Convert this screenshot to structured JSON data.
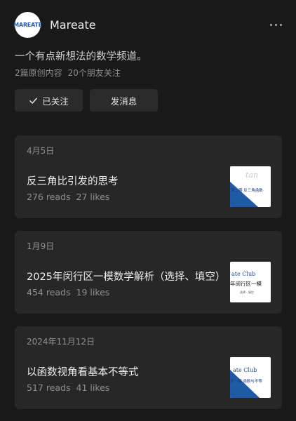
{
  "account": {
    "name": "Mareate",
    "logo_text": "MAREATE",
    "description": "一个有点新想法的数学频道。",
    "stats": {
      "articles": "2篇原创内容",
      "friends": "20个朋友关注"
    }
  },
  "actions": {
    "follow_label": "已关注",
    "message_label": "发消息"
  },
  "articles": [
    {
      "date": "4月5日",
      "title": "反三角比引发的思考",
      "reads": "276 reads",
      "likes": "27 likes",
      "thumb": {
        "style": "blue-diagonal",
        "line1": "tan",
        "line2": "第二期  反三角函数"
      }
    },
    {
      "date": "1月9日",
      "title": "2025年闵行区一模数学解析（选择、填空）",
      "reads": "454 reads",
      "likes": "19 likes",
      "thumb": {
        "style": "white",
        "line1": "ate Club",
        "line2": "年闵行区一模",
        "line3": "选择 · 填空"
      }
    },
    {
      "date": "2024年11月12日",
      "title": "以函数视角看基本不等式",
      "reads": "517 reads",
      "likes": "41 likes",
      "thumb": {
        "style": "blue-diagonal",
        "line1": "ate Club",
        "line2": "第一期  函数与不等"
      }
    }
  ],
  "colors": {
    "background": "#191919",
    "card": "#272727",
    "button": "#2b2b2b",
    "thumb_blue": "#1f5aa6"
  },
  "icons": {
    "follow": "checkmark-icon",
    "more": "more-dots-icon"
  }
}
